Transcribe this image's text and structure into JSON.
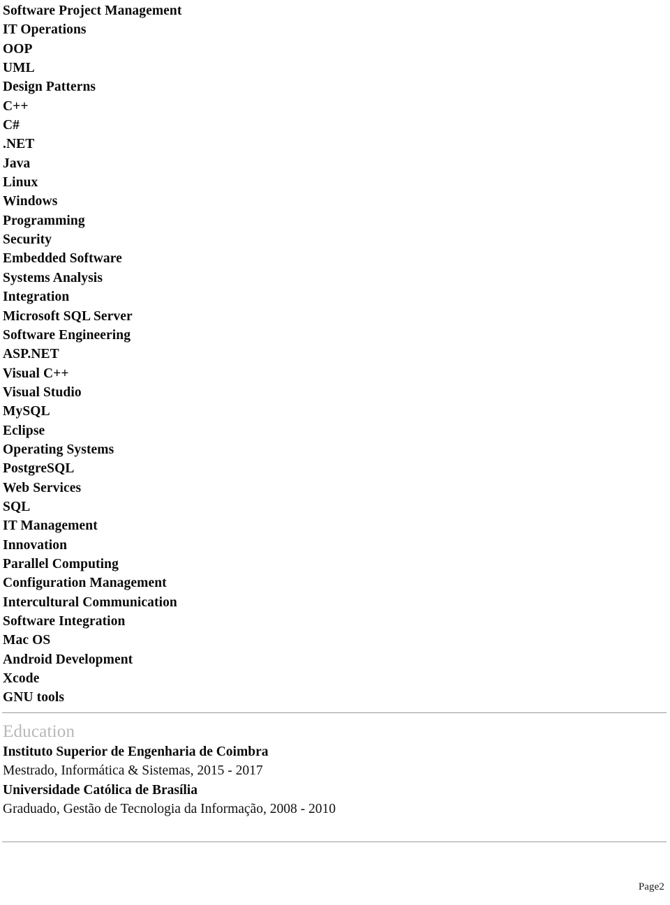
{
  "document": {
    "skills": [
      "Software Project Management",
      "IT Operations",
      "OOP",
      "UML",
      "Design Patterns",
      "C++",
      "C#",
      ".NET",
      "Java",
      "Linux",
      "Windows",
      "Programming",
      "Security",
      "Embedded Software",
      "Systems Analysis",
      "Integration",
      "Microsoft SQL Server",
      "Software Engineering",
      "ASP.NET",
      "Visual C++",
      "Visual Studio",
      "MySQL",
      "Eclipse",
      "Operating Systems",
      "PostgreSQL",
      "Web Services",
      "SQL",
      "IT Management",
      "Innovation",
      "Parallel Computing",
      "Configuration Management",
      "Intercultural Communication",
      "Software Integration",
      "Mac OS",
      "Android Development",
      "Xcode",
      "GNU tools"
    ],
    "education": {
      "heading": "Education",
      "entries": [
        {
          "school": "Instituto Superior de Engenharia de Coimbra",
          "detail": "Mestrado, Informática & Sistemas, 2015 - 2017"
        },
        {
          "school": "Universidade Católica de Brasília",
          "detail": "Graduado, Gestão de Tecnologia da Informação, 2008 - 2010"
        }
      ]
    },
    "footer": {
      "page_number": "Page2"
    },
    "colors": {
      "heading_gray": "#b7b7b7",
      "rule_gray": "#9a9a9a",
      "body_text": "#0a0a0a"
    }
  }
}
